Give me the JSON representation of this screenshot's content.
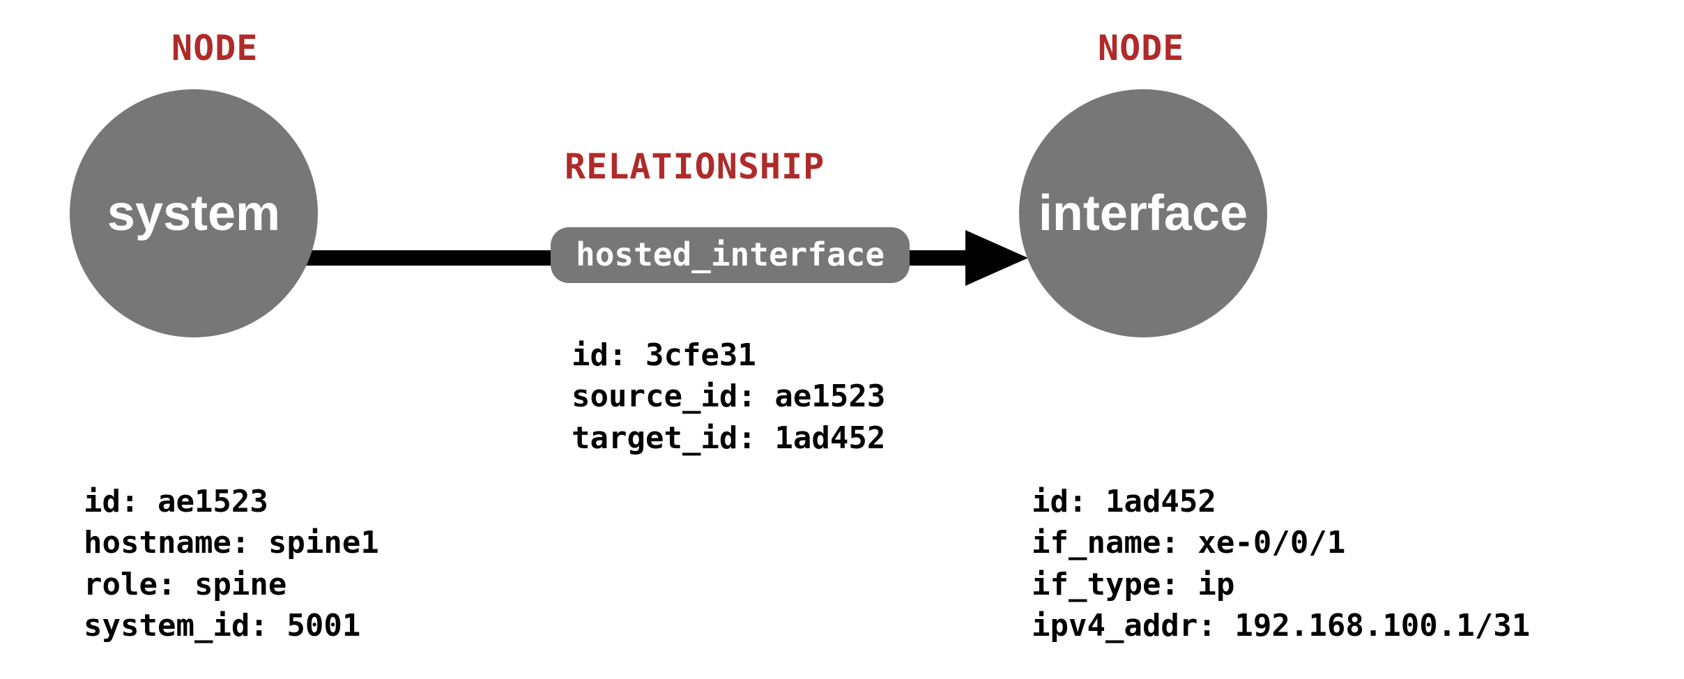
{
  "left_node": {
    "header": "NODE",
    "type_label": "system",
    "props_text": "id: ae1523\nhostname: spine1\nrole: spine\nsystem_id: 5001"
  },
  "relationship": {
    "header": "RELATIONSHIP",
    "type_label": "hosted_interface",
    "props_text": "id: 3cfe31\nsource_id: ae1523\ntarget_id: 1ad452"
  },
  "right_node": {
    "header": "NODE",
    "type_label": "interface",
    "props_text": "id: 1ad452\nif_name: xe-0/0/1\nif_type: ip\nipv4_addr: 192.168.100.1/31"
  }
}
